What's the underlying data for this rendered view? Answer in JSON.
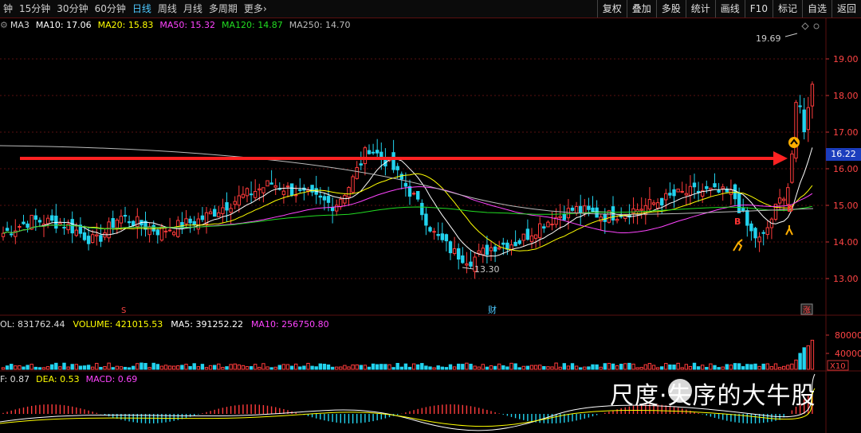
{
  "toolbar": {
    "periods": [
      {
        "label": "钟",
        "active": false
      },
      {
        "label": "15分钟",
        "active": false
      },
      {
        "label": "30分钟",
        "active": false
      },
      {
        "label": "60分钟",
        "active": false
      },
      {
        "label": "日线",
        "active": true
      },
      {
        "label": "周线",
        "active": false
      },
      {
        "label": "月线",
        "active": false
      },
      {
        "label": "多周期",
        "active": false
      },
      {
        "label": "更多",
        "active": false
      }
    ],
    "more_arrow": "›",
    "buttons": [
      "复权",
      "叠加",
      "多股",
      "统计",
      "画线",
      "F10",
      "标记",
      "自选",
      "返回"
    ]
  },
  "ma_legend": {
    "icon": "gear-icon",
    "name": "MA3",
    "items": [
      {
        "label": "MA10: 17.06",
        "color": "#ffffff"
      },
      {
        "label": "MA20: 15.83",
        "color": "#ffff00"
      },
      {
        "label": "MA50: 15.32",
        "color": "#ff44ff"
      },
      {
        "label": "MA120: 14.87",
        "color": "#22dd22"
      },
      {
        "label": "MA250: 14.70",
        "color": "#bbbbbb"
      }
    ]
  },
  "price_axis": {
    "ticks": [
      "19.00",
      "18.00",
      "17.00",
      "16.00",
      "15.00",
      "14.00",
      "13.00"
    ],
    "current_price": "16.22"
  },
  "annotations": {
    "high_label": "19.69",
    "low_label": "13.30",
    "marker_s": "S",
    "marker_cai": "财",
    "marker_zhang": "涨",
    "marker_b": "B"
  },
  "volume_legend": {
    "items": [
      {
        "label": "OL: 831762.44",
        "color": "#dddddd"
      },
      {
        "label": "VOLUME: 421015.53",
        "color": "#ffff00"
      },
      {
        "label": "MA5: 391252.22",
        "color": "#ffffff"
      },
      {
        "label": "MA10: 256750.80",
        "color": "#ff44ff"
      }
    ],
    "axis": [
      "80000",
      "40000"
    ],
    "unit": "X10"
  },
  "macd_legend": {
    "items": [
      {
        "label": "F: 0.87",
        "color": "#dddddd"
      },
      {
        "label": "DEA: 0.53",
        "color": "#ffff00"
      },
      {
        "label": "MACD: 0.69",
        "color": "#ff44ff"
      }
    ]
  },
  "watermark": {
    "text": "尺度·失序的大牛股"
  },
  "colors": {
    "up": "#ff3b3b",
    "down": "#22d3ee",
    "arrow": "#ff2222",
    "grid": "#5a1010"
  }
}
